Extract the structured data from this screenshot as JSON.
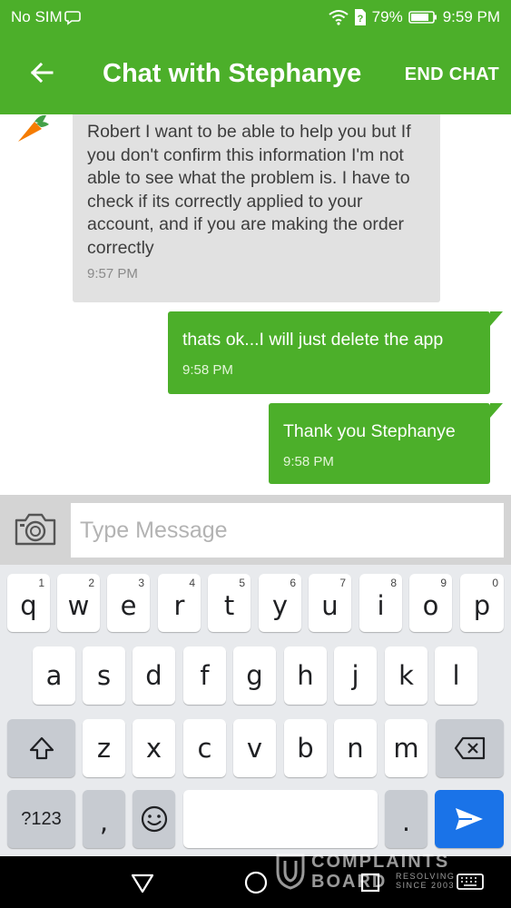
{
  "status_bar": {
    "carrier": "No SIM",
    "battery": "79%",
    "time": "9:59 PM"
  },
  "app_bar": {
    "title": "Chat with Stephanye",
    "end_chat": "END CHAT"
  },
  "messages": [
    {
      "direction": "incoming",
      "text": "Robert I want to be able to help you but If you don't confirm this information I'm not able to see what the problem is. I have to check if its correctly applied to your account, and if you are making the order correctly",
      "time": "9:57 PM"
    },
    {
      "direction": "outgoing",
      "text": "thats ok...I will just delete the app",
      "time": "9:58 PM"
    },
    {
      "direction": "outgoing",
      "text": "Thank you Stephanye",
      "time": "9:58 PM"
    }
  ],
  "input": {
    "placeholder": "Type Message",
    "value": ""
  },
  "keyboard": {
    "row1": [
      {
        "key": "q",
        "sup": "1"
      },
      {
        "key": "w",
        "sup": "2"
      },
      {
        "key": "e",
        "sup": "3"
      },
      {
        "key": "r",
        "sup": "4"
      },
      {
        "key": "t",
        "sup": "5"
      },
      {
        "key": "y",
        "sup": "6"
      },
      {
        "key": "u",
        "sup": "7"
      },
      {
        "key": "i",
        "sup": "8"
      },
      {
        "key": "o",
        "sup": "9"
      },
      {
        "key": "p",
        "sup": "0"
      }
    ],
    "row2": [
      "a",
      "s",
      "d",
      "f",
      "g",
      "h",
      "j",
      "k",
      "l"
    ],
    "row3": [
      "z",
      "x",
      "c",
      "v",
      "b",
      "n",
      "m"
    ],
    "symbols": "?123",
    "comma": ",",
    "period": "."
  },
  "watermark": {
    "line1": "COMPLAINTS",
    "line2": "BOARD",
    "tag1": "RESOLVING",
    "tag2": "SINCE 2003"
  },
  "colors": {
    "brand_green": "#4caf2a",
    "incoming_bubble": "#e1e1e1",
    "send_key": "#1a73e8"
  },
  "icons": [
    "back-arrow-icon",
    "wifi-icon",
    "battery-icon",
    "carrot-icon",
    "camera-icon",
    "shift-icon",
    "backspace-icon",
    "emoji-icon",
    "send-icon",
    "nav-back-icon",
    "nav-home-icon",
    "nav-recents-icon",
    "keyboard-icon"
  ]
}
